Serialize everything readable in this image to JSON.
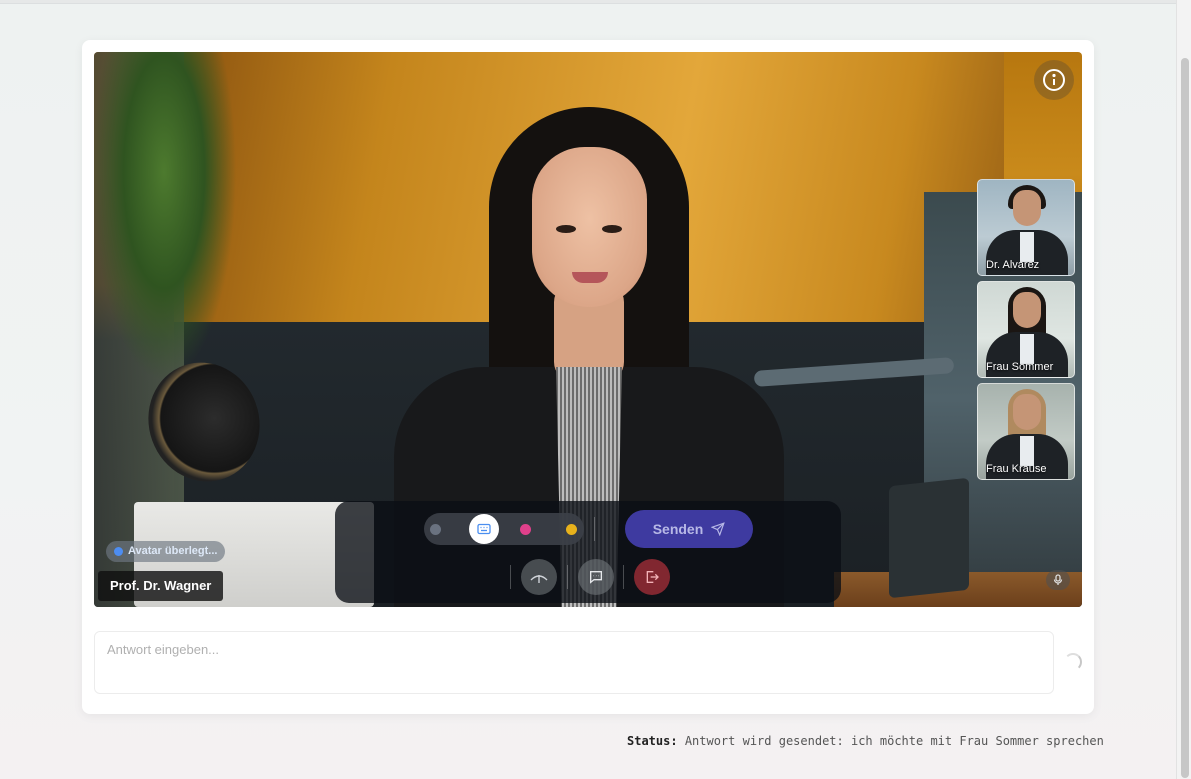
{
  "stage": {
    "speaker_name": "Prof. Dr. Wagner",
    "status_pill": "Avatar überlegt...",
    "icons": {
      "info": "info-icon",
      "mic": "microphone-icon"
    }
  },
  "participants": [
    {
      "name": "Dr. Alvarez"
    },
    {
      "name": "Frau Sommer"
    },
    {
      "name": "Frau Krause"
    }
  ],
  "controls": {
    "send_label": "Senden",
    "colors": {
      "gray": "#6a7280",
      "active": "#ffffff",
      "pink": "#e0408b",
      "yellow": "#e8b21c",
      "send_bg": "#3e3aa0"
    },
    "icons": [
      "keyboard-icon",
      "send-icon",
      "antenna-icon",
      "chat-icon",
      "exit-icon"
    ]
  },
  "answer": {
    "placeholder": "Antwort eingeben..."
  },
  "status": {
    "label": "Status:",
    "text": "Antwort wird gesendet: ich möchte mit Frau Sommer sprechen"
  }
}
